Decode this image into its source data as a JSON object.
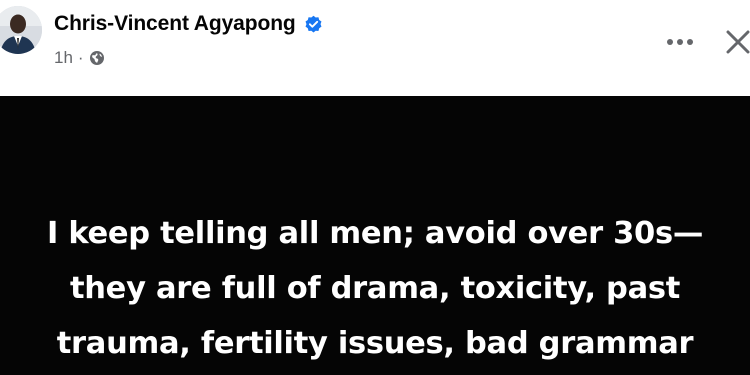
{
  "author": {
    "name": "Chris-Vincent Agyapong",
    "verified": true,
    "verified_color": "#1877f2"
  },
  "meta": {
    "time": "1h",
    "separator": "·",
    "audience_icon": "globe-icon"
  },
  "actions": {
    "more_icon": "more-horizontal-icon",
    "close_icon": "close-icon"
  },
  "post": {
    "background": "#050505",
    "text_color": "#ffffff",
    "lines": [
      "I keep telling all men; avoid over 30s—",
      "they are full of drama, toxicity, past",
      "trauma, fertility issues, bad grammar"
    ]
  }
}
